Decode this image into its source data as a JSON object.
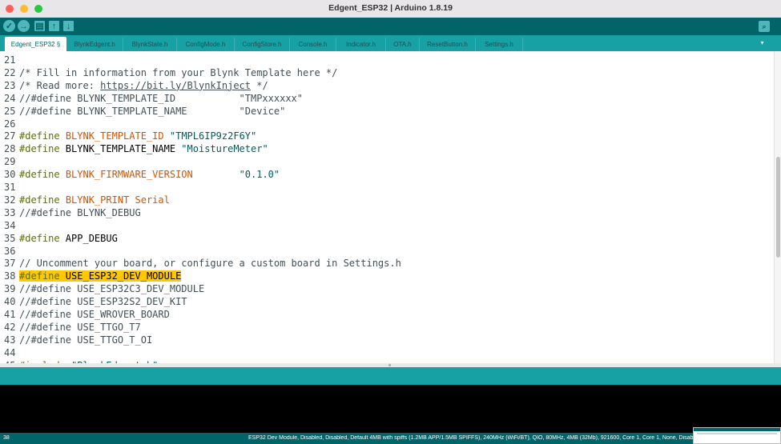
{
  "window": {
    "title": "Edgent_ESP32 | Arduino 1.8.19"
  },
  "toolbar": {
    "buttons": [
      {
        "name": "verify",
        "glyph": "✓"
      },
      {
        "name": "upload",
        "glyph": "→"
      },
      {
        "name": "new",
        "glyph": "▤"
      },
      {
        "name": "open",
        "glyph": "↑"
      },
      {
        "name": "save",
        "glyph": "↓"
      }
    ],
    "serial_glyph": "⌕"
  },
  "tabs": [
    "Edgent_ESP32 §",
    "BlynkEdgent.h",
    "BlynkState.h",
    "ConfigMode.h",
    "ConfigStore.h",
    "Console.h",
    "Indicator.h",
    "OTA.h",
    "ResetButton.h",
    "Settings.h"
  ],
  "tab_menu_glyph": "▾",
  "code": [
    {
      "n": "21",
      "parts": []
    },
    {
      "n": "22",
      "parts": [
        {
          "t": "c-comment",
          "v": "/* Fill in information from your Blynk Template here */"
        }
      ]
    },
    {
      "n": "23",
      "parts": [
        {
          "t": "c-comment",
          "v": "/* Read more: "
        },
        {
          "t": "c-comment c-url",
          "v": "https://bit.ly/BlynkInject"
        },
        {
          "t": "c-comment",
          "v": " */"
        }
      ]
    },
    {
      "n": "24",
      "parts": [
        {
          "t": "c-comment",
          "v": "//#define BLYNK_TEMPLATE_ID           \"TMPxxxxxx\""
        }
      ]
    },
    {
      "n": "25",
      "parts": [
        {
          "t": "c-comment",
          "v": "//#define BLYNK_TEMPLATE_NAME         \"Device\""
        }
      ]
    },
    {
      "n": "26",
      "parts": []
    },
    {
      "n": "27",
      "parts": [
        {
          "t": "c-define",
          "v": "#define"
        },
        {
          "t": "c-plain",
          "v": " "
        },
        {
          "t": "c-blynk",
          "v": "BLYNK_TEMPLATE_ID"
        },
        {
          "t": "c-plain",
          "v": " "
        },
        {
          "t": "c-str",
          "v": "\"TMPL6IP9z2F6Y\""
        }
      ]
    },
    {
      "n": "28",
      "parts": [
        {
          "t": "c-define",
          "v": "#define"
        },
        {
          "t": "c-plain",
          "v": " BLYNK_TEMPLATE_NAME "
        },
        {
          "t": "c-str",
          "v": "\"MoistureMeter\""
        }
      ]
    },
    {
      "n": "29",
      "parts": []
    },
    {
      "n": "30",
      "parts": [
        {
          "t": "c-define",
          "v": "#define"
        },
        {
          "t": "c-plain",
          "v": " "
        },
        {
          "t": "c-blynk",
          "v": "BLYNK_FIRMWARE_VERSION"
        },
        {
          "t": "c-plain",
          "v": "        "
        },
        {
          "t": "c-str",
          "v": "\"0.1.0\""
        }
      ]
    },
    {
      "n": "31",
      "parts": []
    },
    {
      "n": "32",
      "parts": [
        {
          "t": "c-define",
          "v": "#define"
        },
        {
          "t": "c-plain",
          "v": " "
        },
        {
          "t": "c-blynk",
          "v": "BLYNK_PRINT Serial"
        }
      ]
    },
    {
      "n": "33",
      "parts": [
        {
          "t": "c-comment",
          "v": "//#define BLYNK_DEBUG"
        }
      ]
    },
    {
      "n": "34",
      "parts": []
    },
    {
      "n": "35",
      "parts": [
        {
          "t": "c-define",
          "v": "#define"
        },
        {
          "t": "c-plain",
          "v": " APP_DEBUG"
        }
      ]
    },
    {
      "n": "36",
      "parts": []
    },
    {
      "n": "37",
      "parts": [
        {
          "t": "c-comment",
          "v": "// Uncomment your board, or configure a custom board in Settings.h"
        }
      ]
    },
    {
      "n": "38",
      "parts": [
        {
          "t": "c-define highlight",
          "v": "#define"
        },
        {
          "t": "c-plain highlight",
          "v": " USE_ESP32_DEV_MODULE"
        }
      ]
    },
    {
      "n": "39",
      "parts": [
        {
          "t": "c-comment",
          "v": "//#define USE_ESP32C3_DEV_MODULE"
        }
      ]
    },
    {
      "n": "40",
      "parts": [
        {
          "t": "c-comment",
          "v": "//#define USE_ESP32S2_DEV_KIT"
        }
      ]
    },
    {
      "n": "41",
      "parts": [
        {
          "t": "c-comment",
          "v": "//#define USE_WROVER_BOARD"
        }
      ]
    },
    {
      "n": "42",
      "parts": [
        {
          "t": "c-comment",
          "v": "//#define USE_TTGO_T7"
        }
      ]
    },
    {
      "n": "43",
      "parts": [
        {
          "t": "c-comment",
          "v": "//#define USE_TTGO_T_OI"
        }
      ]
    },
    {
      "n": "44",
      "parts": []
    },
    {
      "n": "45",
      "parts": [
        {
          "t": "c-define",
          "v": "#include"
        },
        {
          "t": "c-plain",
          "v": " "
        },
        {
          "t": "c-str",
          "v": "\"BlynkEdgent.h\""
        }
      ]
    }
  ],
  "footer": {
    "line_number": "38",
    "board_info": "ESP32 Dev Module, Disabled, Disabled, Default 4MB with spiffs (1.2MB APP/1.5MB SPIFFS), 240MHz (WiFi/BT), QIO, 80MHz, 4MB (32Mb), 921600, Core 1, Core 1, None, Disab"
  }
}
